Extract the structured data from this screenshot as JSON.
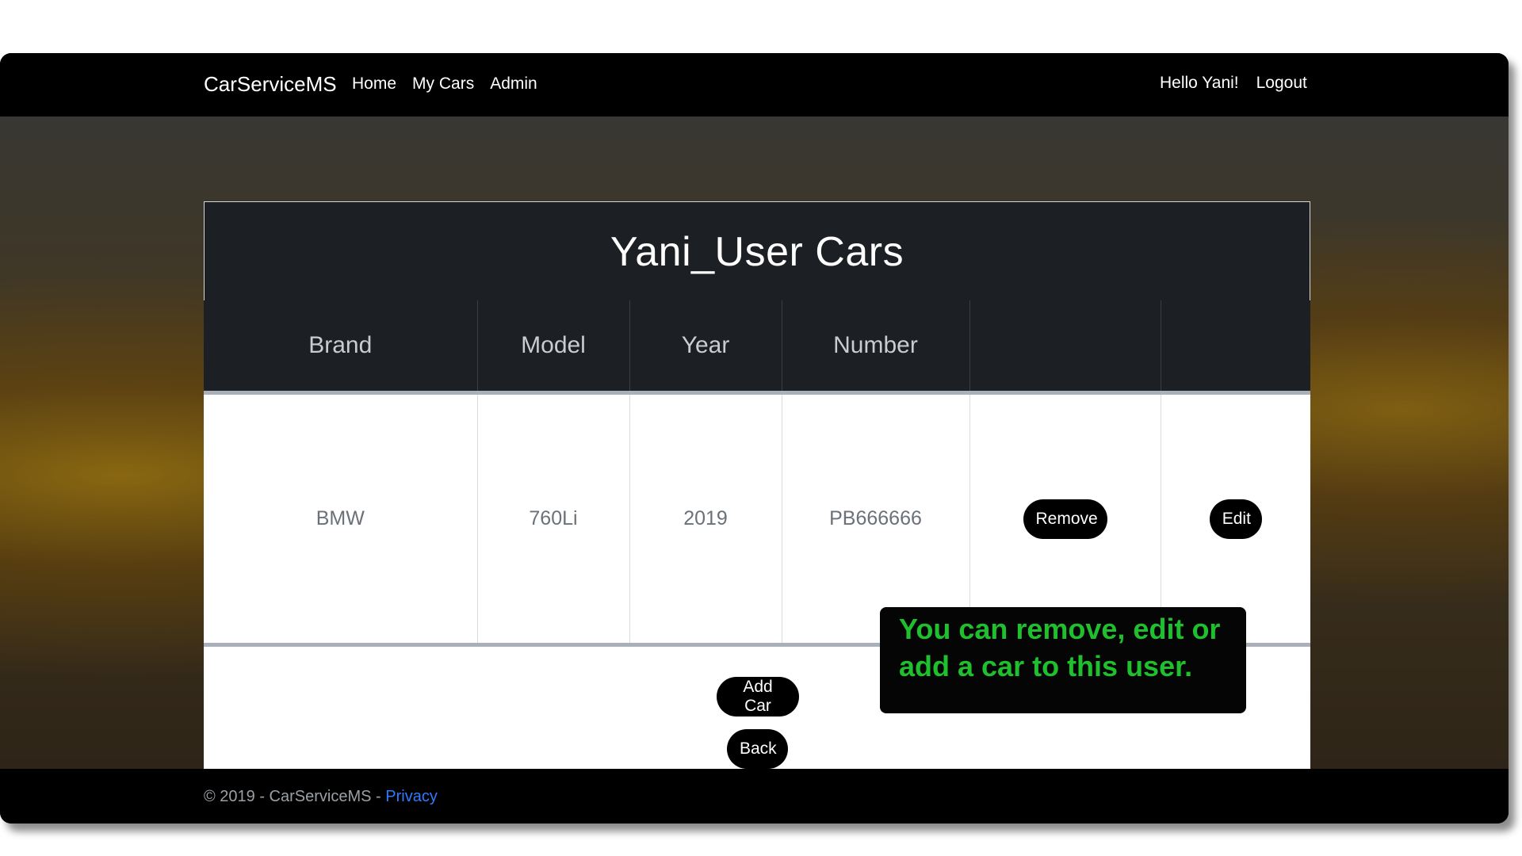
{
  "navbar": {
    "brand": "CarServiceMS",
    "links": [
      "Home",
      "My Cars",
      "Admin"
    ],
    "greeting": "Hello Yani!",
    "logout": "Logout"
  },
  "page": {
    "title": "Yani_User Cars"
  },
  "table": {
    "headers": [
      "Brand",
      "Model",
      "Year",
      "Number",
      "",
      ""
    ],
    "rows": [
      {
        "brand": "BMW",
        "model": "760Li",
        "year": "2019",
        "number": "PB666666",
        "remove_label": "Remove",
        "edit_label": "Edit"
      }
    ]
  },
  "actions": {
    "add_car_label": "Add Car",
    "back_label": "Back"
  },
  "tooltip": {
    "text": "You can remove, edit or add a car to this user."
  },
  "footer": {
    "copyright": "© 2019 - CarServiceMS - ",
    "privacy": "Privacy"
  },
  "colors": {
    "navbar_bg": "#000000",
    "header_bg": "#1c1f24",
    "tooltip_text": "#1fbf2d",
    "link": "#2e7bff"
  }
}
